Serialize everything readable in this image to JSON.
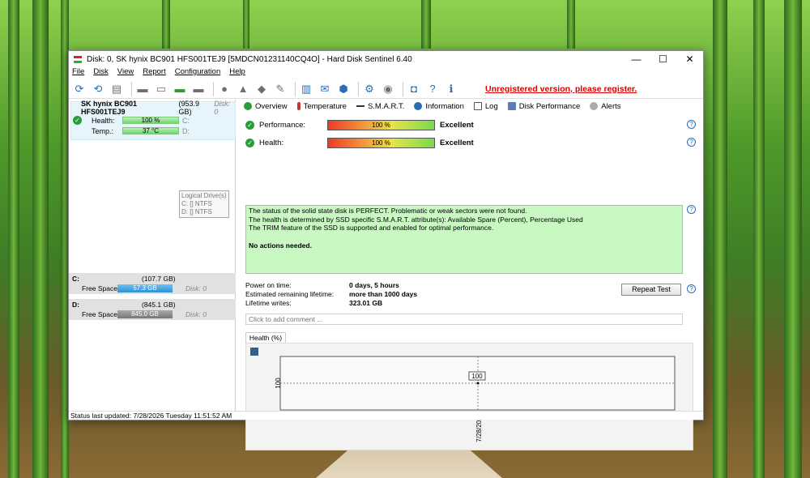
{
  "window": {
    "title": "Disk: 0, SK hynix BC901 HFS001TEJ9 [5MDCN01231140CQ4O]  -  Hard Disk Sentinel 6.40",
    "minimize": "—",
    "maximize": "☐",
    "close": "✕"
  },
  "menu": [
    "File",
    "Disk",
    "View",
    "Report",
    "Configuration",
    "Help"
  ],
  "toolbar": {
    "unregistered": "Unregistered version, please register."
  },
  "left": {
    "disk_name": "SK hynix BC901 HFS001TEJ9",
    "disk_size": "(953.9 GB)",
    "disk_index": "Disk: 0",
    "health_label": "Health:",
    "health_value": "100 %",
    "temp_label": "Temp.:",
    "temp_value": "37 °C",
    "drive_c_small": "C:",
    "drive_d_small": "D:",
    "tooltip": {
      "title": "Logical Drive(s)",
      "line1": "C: [] NTFS",
      "line2": "D: [] NTFS"
    },
    "drives": [
      {
        "letter": "C:",
        "size": "(107.7 GB)",
        "free_label": "Free Space",
        "free": "57.3 GB",
        "disk": "Disk: 0"
      },
      {
        "letter": "D:",
        "size": "(845.1 GB)",
        "free_label": "Free Space",
        "free": "845.0 GB",
        "disk": "Disk: 0"
      }
    ]
  },
  "tabs": [
    "Overview",
    "Temperature",
    "S.M.A.R.T.",
    "Information",
    "Log",
    "Disk Performance",
    "Alerts"
  ],
  "overview": {
    "performance_label": "Performance:",
    "performance_value": "100 %",
    "performance_rating": "Excellent",
    "health_label": "Health:",
    "health_value": "100 %",
    "health_rating": "Excellent",
    "status_lines": [
      "The status of the solid state disk is PERFECT. Problematic or weak sectors were not found.",
      "The health is determined by SSD specific S.M.A.R.T. attribute(s):  Available Spare (Percent), Percentage Used",
      "The TRIM feature of the SSD is supported and enabled for optimal performance."
    ],
    "status_action": "No actions needed.",
    "power_on_label": "Power on time:",
    "power_on_value": "0 days, 5 hours",
    "remaining_label": "Estimated remaining lifetime:",
    "remaining_value": "more than 1000 days",
    "writes_label": "Lifetime writes:",
    "writes_value": "323.01 GB",
    "repeat_button": "Repeat Test",
    "comment_placeholder": "Click to add comment ..."
  },
  "chart_data": {
    "type": "line",
    "title": "Health (%)",
    "x": [
      "7/28/2026"
    ],
    "series": [
      {
        "values": [
          100
        ]
      }
    ],
    "ytick": "100",
    "point_label": "100"
  },
  "status_bar": "Status last updated: 7/28/2026 Tuesday 11:51:52 AM"
}
